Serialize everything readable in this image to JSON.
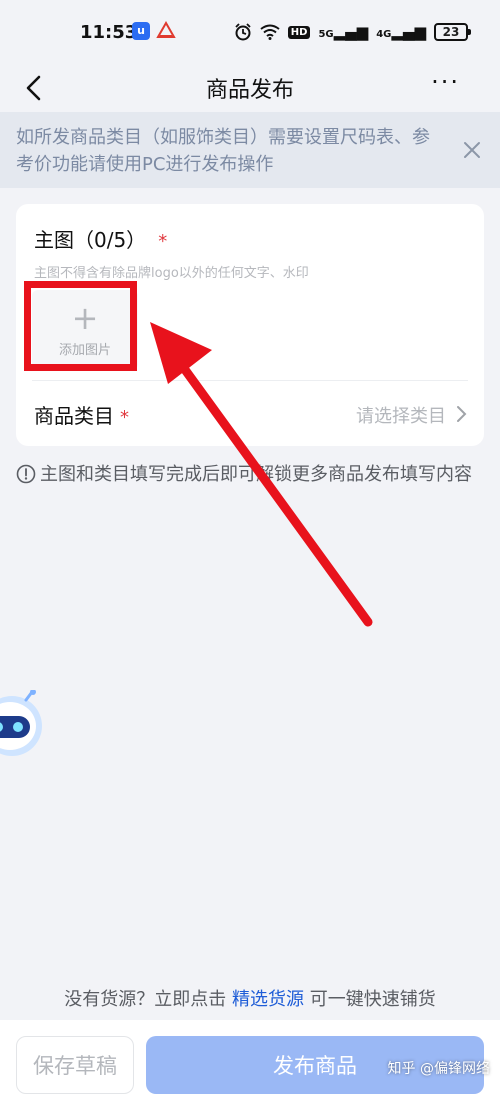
{
  "status_bar": {
    "time": "11:53",
    "app_icon_1": "u",
    "hd_badge": "HD",
    "signal_1": "5G",
    "signal_2": "4G",
    "battery": "23"
  },
  "nav": {
    "title": "商品发布",
    "more": "···"
  },
  "notice": {
    "text": "如所发商品类目（如服饰类目）需要设置尺码表、参考价功能请使用PC进行发布操作"
  },
  "main_image": {
    "title": "主图（0/5）",
    "required_mark": "*",
    "hint": "主图不得含有除品牌logo以外的任何文字、水印",
    "add_plus": "+",
    "add_label": "添加图片"
  },
  "category": {
    "label": "商品类目",
    "required_mark": "*",
    "placeholder": "请选择类目"
  },
  "unlock_tip": "主图和类目填写完成后即可解锁更多商品发布填写内容",
  "source_tip": {
    "prefix": "没有货源？立即点击",
    "link": "精选货源",
    "suffix": "可一键快速铺货"
  },
  "actions": {
    "save_draft": "保存草稿",
    "publish": "发布商品"
  },
  "watermark": "知乎 @偏锋网络",
  "colors": {
    "accent": "#1f5dd7",
    "publish_disabled": "#9ab8f5",
    "annotation_red": "#e8121c",
    "required": "#e0383e"
  }
}
